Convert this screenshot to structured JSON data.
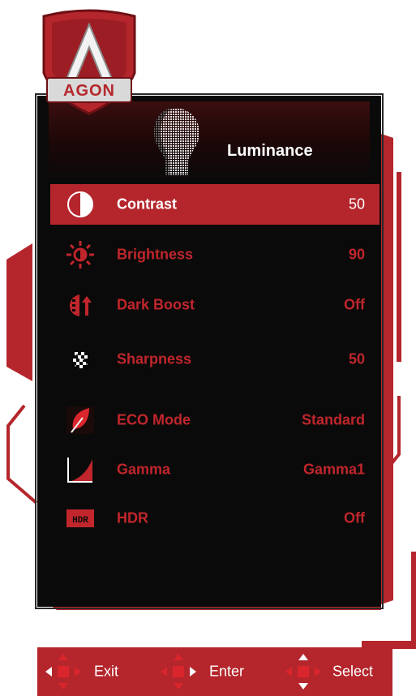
{
  "brand": "AGON",
  "menu_title": "Luminance",
  "items": [
    {
      "label": "Contrast",
      "value": "50",
      "icon": "contrast-icon",
      "selected": true
    },
    {
      "label": "Brightness",
      "value": "90",
      "icon": "brightness-icon"
    },
    {
      "label": "Dark Boost",
      "value": "Off",
      "icon": "dark-boost-icon"
    },
    {
      "label": "Sharpness",
      "value": "50",
      "icon": "sharpness-icon"
    },
    {
      "label": "ECO Mode",
      "value": "Standard",
      "icon": "eco-leaf-icon"
    },
    {
      "label": "Gamma",
      "value": "Gamma1",
      "icon": "gamma-curve-icon"
    },
    {
      "label": "HDR",
      "value": "Off",
      "icon": "hdr-icon"
    }
  ],
  "hdr_badge": "HDR",
  "footer": {
    "exit": "Exit",
    "enter": "Enter",
    "select": "Select"
  },
  "colors": {
    "accent": "#b4262c",
    "panel": "#0a0a0a",
    "text_inactive": "#c0262c"
  }
}
